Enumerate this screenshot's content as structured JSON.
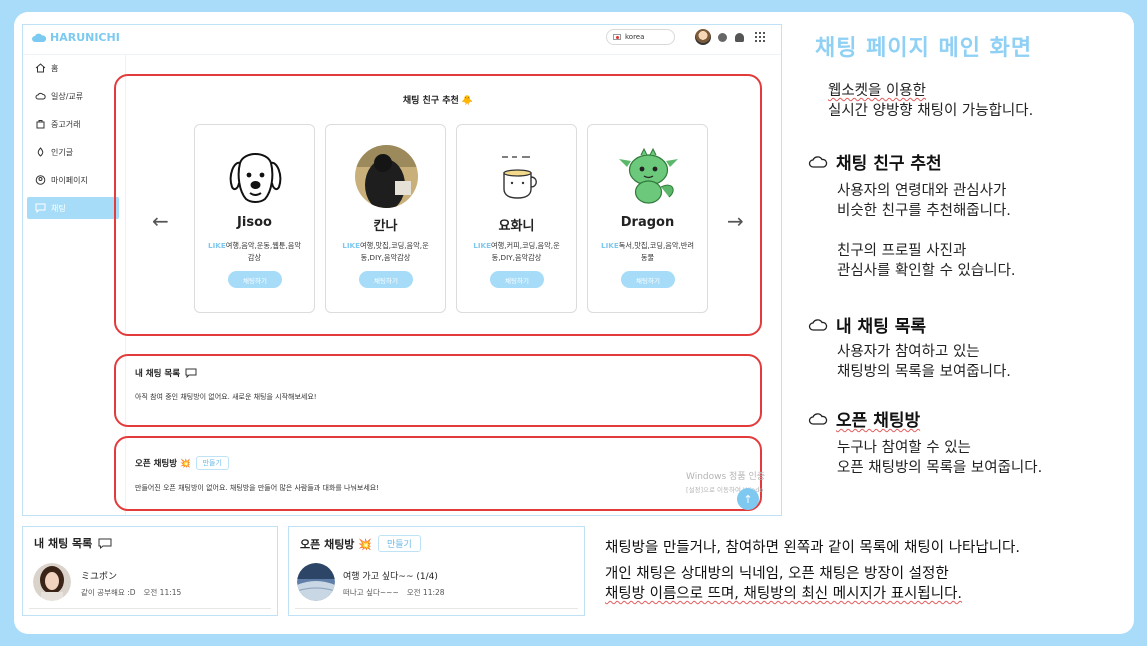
{
  "app": {
    "logo": "HARUNICHI",
    "language": "korea",
    "sidebar": [
      {
        "label": "홈",
        "icon": "home-icon"
      },
      {
        "label": "일상/교류",
        "icon": "cloud-icon"
      },
      {
        "label": "중고거래",
        "icon": "bag-icon"
      },
      {
        "label": "인기글",
        "icon": "flame-icon"
      },
      {
        "label": "마이페이지",
        "icon": "user-icon"
      },
      {
        "label": "채팅",
        "icon": "chat-icon",
        "active": true
      }
    ],
    "recommend": {
      "title": "채팅 친구 추천 🐥",
      "prev": "←",
      "next": "→",
      "like_label": "LIKE",
      "chat_button": "채팅하기",
      "cards": [
        {
          "name": "Jisoo",
          "interests_line1": "여행,음악,운동,웹툰,음악",
          "interests_line2": "감상"
        },
        {
          "name": "칸나",
          "interests_line1": "여행,맛집,코딩,음악,운",
          "interests_line2": "동,DIY,음악감상"
        },
        {
          "name": "요화니",
          "interests_line1": "여행,커피,코딩,음악,운",
          "interests_line2": "동,DIY,음악감상"
        },
        {
          "name": "Dragon",
          "interests_line1": "독서,맛집,코딩,음악,반려",
          "interests_line2": "동물"
        }
      ]
    },
    "my_chats": {
      "title": "내 채팅 목록",
      "empty": "아직 참여 중인 채팅방이 없어요. 새로운 채팅을 시작해보세요!"
    },
    "open_chats": {
      "title": "오픈 채팅방 💥",
      "make_button": "만들기",
      "empty": "만들어진 오픈 채팅방이 없어요. 채팅방을 만들어 많은 사람들과 대화를 나눠보세요!"
    },
    "watermark_line1": "Windows 정품 인증",
    "watermark_line2": "[설정]으로 이동하여 Windo",
    "fab": "↑"
  },
  "description": {
    "heading": "채팅 페이지 메인 화면",
    "intro_line1": "웹소켓을 이용한",
    "intro_line2": "실시간 양방향 채팅이 가능합니다.",
    "features": [
      {
        "title": "채팅 친구 추천",
        "lines": [
          "사용자의 연령대와 관심사가",
          "비슷한 친구를 추천해줍니다.",
          "",
          "친구의 프로필 사진과",
          "관심사를 확인할 수 있습니다."
        ]
      },
      {
        "title": "내 채팅 목록",
        "lines": [
          "사용자가 참여하고 있는",
          "채팅방의 목록을 보여줍니다."
        ]
      },
      {
        "title": "오픈 채팅방",
        "lines": [
          "누구나 참여할 수 있는",
          "오픈 채팅방의 목록을 보여줍니다."
        ]
      }
    ],
    "bottom_line1": "채팅방을 만들거나, 참여하면 왼쪽과 같이 목록에 채팅이 나타납니다.",
    "bottom_line2": "개인 채팅은 상대방의 닉네임, 오픈 채팅은 방장이 설정한",
    "bottom_line3": "채팅방 이름으로 뜨며, 채팅방의 최신 메시지가 표시됩니다."
  },
  "panels": {
    "my_chat": {
      "title": "내 채팅 목록",
      "name": "ミユポン",
      "message": "같이 공부해요 :D",
      "time": "오전 11:15"
    },
    "open_chat": {
      "title": "오픈 채팅방 💥",
      "make_button": "만들기",
      "name": "여행 가고 싶다~~ (1/4)",
      "message": "떠나고 싶다~~~",
      "time": "오전 11:28"
    }
  },
  "colors": {
    "accent": "#a6dcf8",
    "heading": "#8fd0f5",
    "highlight_border": "#e33b3b",
    "background": "#a9dcf8"
  }
}
